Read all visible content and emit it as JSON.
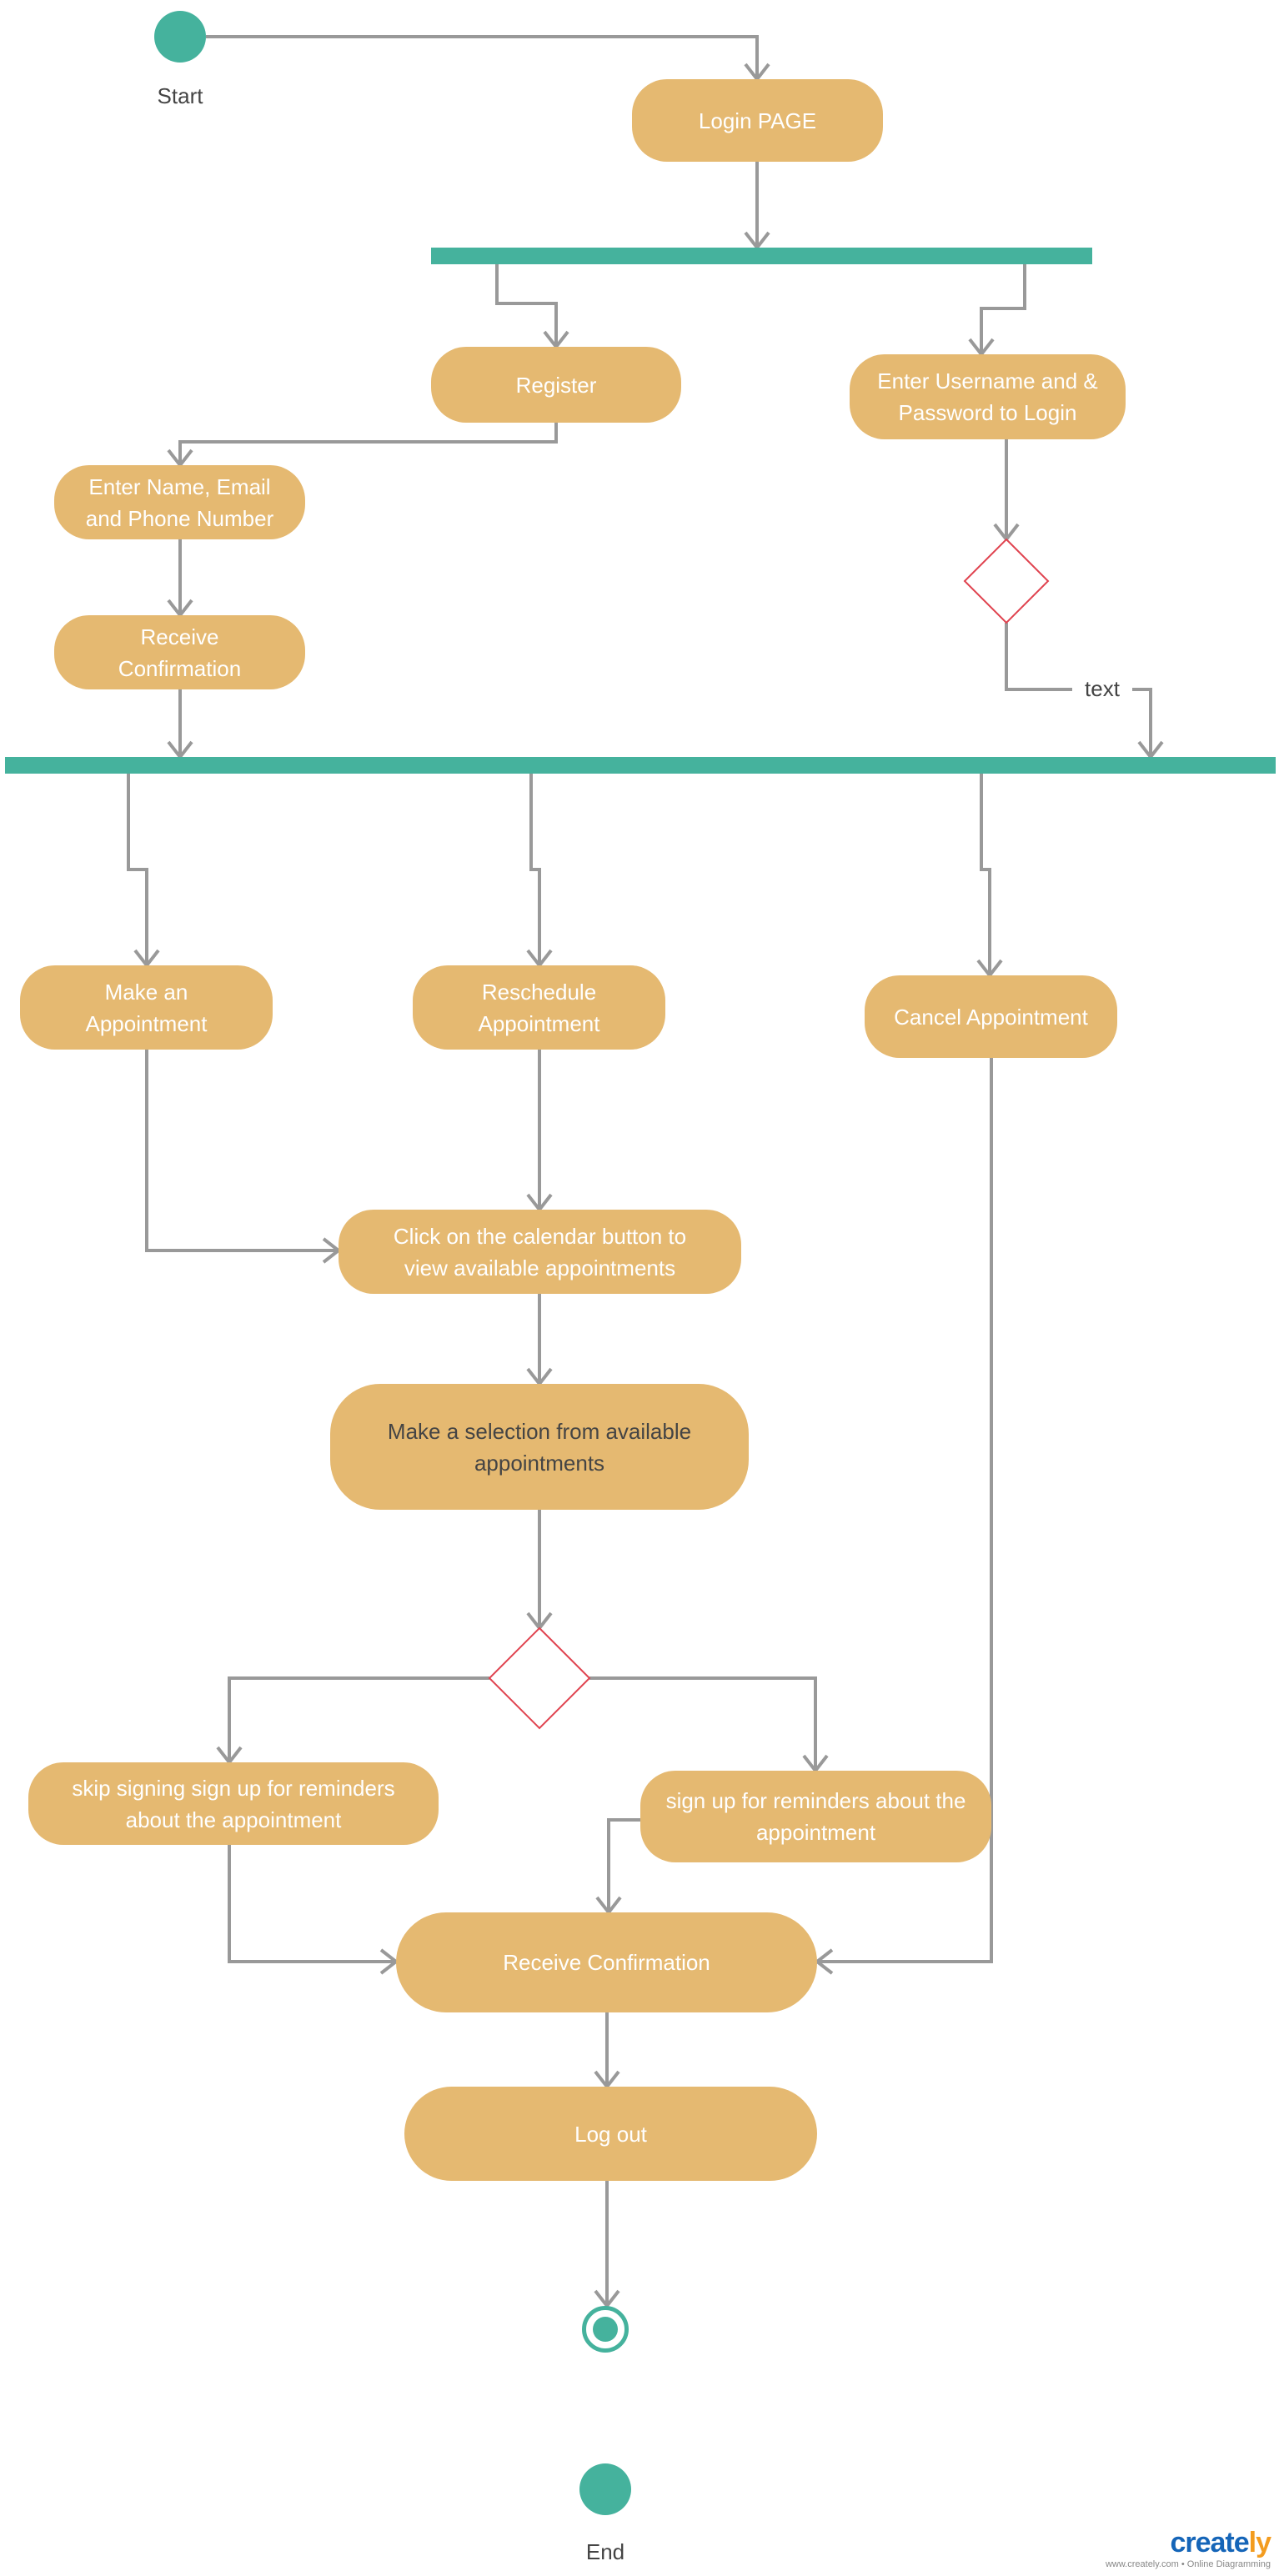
{
  "colors": {
    "activity": "#E5B971",
    "bar": "#45B29D",
    "connector": "#999999",
    "decision": "#E0434F"
  },
  "start_label": "Start",
  "end_label": "End",
  "guard_label": "text",
  "nodes": {
    "login": "Login PAGE",
    "register": "Register",
    "enter_credentials": "Enter Username and & Password to Login",
    "enter_details": "Enter Name, Email and Phone Number",
    "receive_confirmation_1": "Receive Confirmation",
    "make_appointment": "Make an Appointment",
    "reschedule": "Reschedule Appointment",
    "cancel": "Cancel Appointment",
    "calendar": "Click on the calendar button to view available appointments",
    "selection": "Make a selection from available appointments",
    "skip_reminders": "skip signing sign up for reminders about the appointment",
    "signup_reminders": "sign up for reminders about the appointment",
    "receive_confirmation_2": "Receive Confirmation",
    "logout": "Log out"
  },
  "watermark": {
    "brand_main": "create",
    "brand_accent": "ly",
    "tagline": "www.creately.com • Online Diagramming"
  }
}
